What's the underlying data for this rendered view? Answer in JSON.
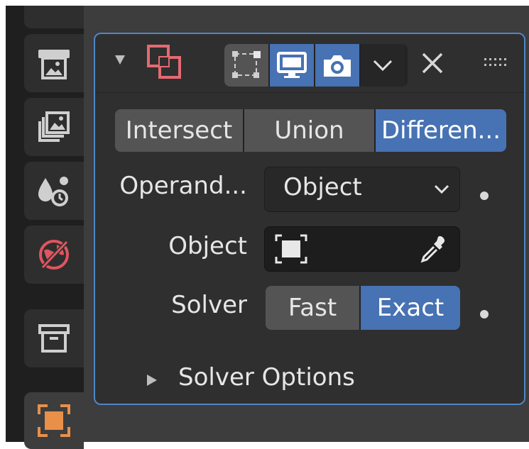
{
  "sidebar": {
    "tabs": [
      {
        "name": "output-properties-tab",
        "icon": "printer-icon"
      },
      {
        "name": "view-layer-properties-tab",
        "icon": "images-icon"
      },
      {
        "name": "scene-properties-tab",
        "icon": "scene-icon"
      },
      {
        "name": "world-properties-tab",
        "icon": "world-icon"
      },
      {
        "name": "collection-properties-tab",
        "icon": "archive-box-icon"
      },
      {
        "name": "object-properties-tab",
        "icon": "object-icon"
      }
    ]
  },
  "modifier": {
    "header": {
      "icon": "boolean-modifier-icon",
      "visibility": {
        "edit_mode": false,
        "viewport": true,
        "render": true
      }
    },
    "operation": {
      "options": [
        "Intersect",
        "Union",
        "Differen..."
      ],
      "selected": "Differen..."
    },
    "operand_type": {
      "label": "Operand...",
      "value": "Object"
    },
    "object": {
      "label": "Object",
      "value": ""
    },
    "solver": {
      "label": "Solver",
      "options": [
        "Fast",
        "Exact"
      ],
      "selected": "Exact"
    },
    "solver_options": {
      "label": "Solver Options",
      "expanded": false
    }
  },
  "colors": {
    "accent": "#4772b3",
    "panel_border": "#4f86c6",
    "world_icon": "#e0555f",
    "object_icon": "#e8904a",
    "boolean_icon": "#e46a72"
  }
}
